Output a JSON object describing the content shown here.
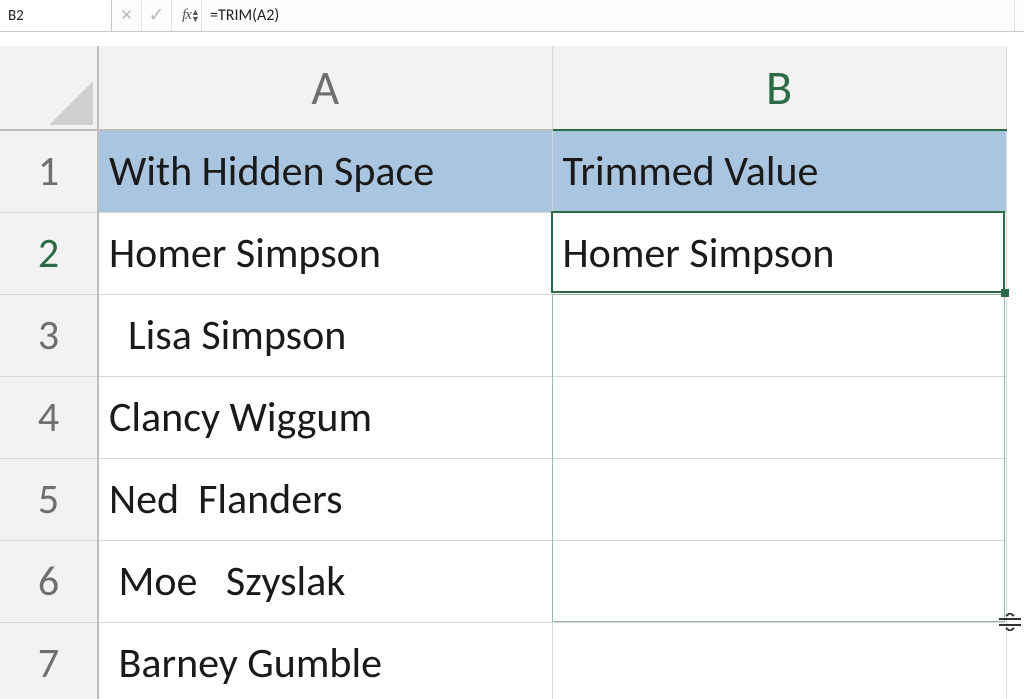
{
  "name_box": {
    "value": "B2"
  },
  "formula_bar": {
    "cancel_tip": "Cancel",
    "enter_tip": "Enter",
    "fx_label": "fx",
    "formula": "=TRIM(A2)"
  },
  "columns": {
    "A": "A",
    "B": "B"
  },
  "row_labels": [
    "1",
    "2",
    "3",
    "4",
    "5",
    "6",
    "7"
  ],
  "cells": {
    "r1": {
      "A": "With Hidden Space",
      "B": "Trimmed Value"
    },
    "r2": {
      "A": "Homer Simpson ",
      "B": "Homer Simpson"
    },
    "r3": {
      "A": "  Lisa Simpson",
      "B": ""
    },
    "r4": {
      "A": "Clancy Wiggum  ",
      "B": ""
    },
    "r5": {
      "A": "Ned  Flanders",
      "B": ""
    },
    "r6": {
      "A": " Moe   Szyslak",
      "B": ""
    },
    "r7": {
      "A": " Barney Gumble",
      "B": ""
    }
  },
  "active_cell": "B2",
  "selection": "B2:B6",
  "colors": {
    "header_fill": "#aac5df",
    "grid_accent": "#2c6b45"
  }
}
